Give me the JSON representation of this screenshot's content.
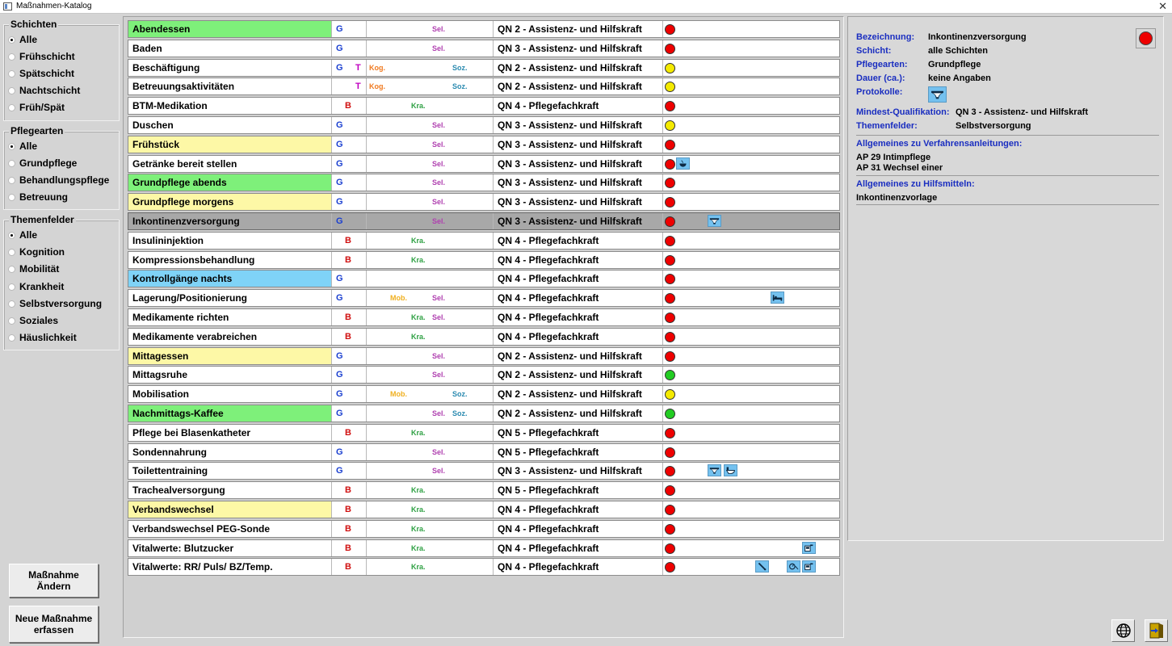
{
  "window": {
    "title": "Maßnahmen-Katalog",
    "close_glyph": "✕"
  },
  "filters": {
    "schichten": {
      "legend": "Schichten",
      "options": [
        "Alle",
        "Frühschicht",
        "Spätschicht",
        "Nachtschicht",
        "Früh/Spät"
      ],
      "selected": 0
    },
    "pflegearten": {
      "legend": "Pflegearten",
      "options": [
        "Alle",
        "Grundpflege",
        "Behandlungspflege",
        "Betreuung"
      ],
      "selected": 0
    },
    "themenfelder": {
      "legend": "Themenfelder",
      "options": [
        "Alle",
        "Kognition",
        "Mobilität",
        "Krankheit",
        "Selbstversorgung",
        "Soziales",
        "Häuslichkeit"
      ],
      "selected": 0
    }
  },
  "buttons": {
    "edit": "Maßnahme Ändern",
    "new": "Neue Maßnahme erfassen"
  },
  "colors": {
    "green": "#7ef07a",
    "yellow": "#fdf8a6",
    "blue": "#7fd3f7",
    "selected": "#a8a8a8"
  },
  "rows": [
    {
      "name": "Abendessen",
      "highlight": "green",
      "g": "G",
      "t": "",
      "b": "",
      "kog": "",
      "mob": "",
      "kra": "",
      "sel": "Sel.",
      "soz": "",
      "qual": "QN 2 - Assistenz- und Hilfskraft",
      "status": "red",
      "icons": []
    },
    {
      "name": "Baden",
      "highlight": "",
      "g": "G",
      "t": "",
      "b": "",
      "kog": "",
      "mob": "",
      "kra": "",
      "sel": "Sel.",
      "soz": "",
      "qual": "QN 3 - Assistenz- und Hilfskraft",
      "status": "red",
      "icons": []
    },
    {
      "name": "Beschäftigung",
      "highlight": "",
      "g": "G",
      "t": "T",
      "b": "",
      "kog": "Kog.",
      "mob": "",
      "kra": "",
      "sel": "",
      "soz": "Soz.",
      "qual": "QN 2 - Assistenz- und Hilfskraft",
      "status": "yellow",
      "icons": []
    },
    {
      "name": "Betreuungsaktivitäten",
      "highlight": "",
      "g": "",
      "t": "T",
      "b": "",
      "kog": "Kog.",
      "mob": "",
      "kra": "",
      "sel": "",
      "soz": "Soz.",
      "qual": "QN 2 - Assistenz- und Hilfskraft",
      "status": "yellow",
      "icons": []
    },
    {
      "name": "BTM-Medikation",
      "highlight": "",
      "g": "",
      "t": "",
      "b": "B",
      "kog": "",
      "mob": "",
      "kra": "Kra.",
      "sel": "",
      "soz": "",
      "qual": "QN 4 - Pflegefachkraft",
      "status": "red",
      "icons": []
    },
    {
      "name": "Duschen",
      "highlight": "",
      "g": "G",
      "t": "",
      "b": "",
      "kog": "",
      "mob": "",
      "kra": "",
      "sel": "Sel.",
      "soz": "",
      "qual": "QN 3 - Assistenz- und Hilfskraft",
      "status": "yellow",
      "icons": []
    },
    {
      "name": "Frühstück",
      "highlight": "yellow",
      "g": "G",
      "t": "",
      "b": "",
      "kog": "",
      "mob": "",
      "kra": "",
      "sel": "Sel.",
      "soz": "",
      "qual": "QN 3 - Assistenz- und Hilfskraft",
      "status": "red",
      "icons": []
    },
    {
      "name": "Getränke bereit stellen",
      "highlight": "",
      "g": "G",
      "t": "",
      "b": "",
      "kog": "",
      "mob": "",
      "kra": "",
      "sel": "Sel.",
      "soz": "",
      "qual": "QN 3 - Assistenz- und Hilfskraft",
      "status": "red",
      "icons": [
        {
          "name": "cup-icon",
          "slot": 0
        }
      ]
    },
    {
      "name": "Grundpflege abends",
      "highlight": "green",
      "g": "G",
      "t": "",
      "b": "",
      "kog": "",
      "mob": "",
      "kra": "",
      "sel": "Sel.",
      "soz": "",
      "qual": "QN 3 - Assistenz- und Hilfskraft",
      "status": "red",
      "icons": []
    },
    {
      "name": "Grundpflege morgens",
      "highlight": "yellow",
      "g": "G",
      "t": "",
      "b": "",
      "kog": "",
      "mob": "",
      "kra": "",
      "sel": "Sel.",
      "soz": "",
      "qual": "QN 3 - Assistenz- und Hilfskraft",
      "status": "red",
      "icons": []
    },
    {
      "name": "Inkontinenzversorgung",
      "highlight": "selected",
      "g": "G",
      "t": "",
      "b": "",
      "kog": "",
      "mob": "",
      "kra": "",
      "sel": "Sel.",
      "soz": "",
      "qual": "QN 3 - Assistenz- und Hilfskraft",
      "status": "red",
      "icons": [
        {
          "name": "brief-icon",
          "slot": 2
        }
      ]
    },
    {
      "name": "Insulininjektion",
      "highlight": "",
      "g": "",
      "t": "",
      "b": "B",
      "kog": "",
      "mob": "",
      "kra": "Kra.",
      "sel": "",
      "soz": "",
      "qual": "QN 4 - Pflegefachkraft",
      "status": "red",
      "icons": []
    },
    {
      "name": "Kompressionsbehandlung",
      "highlight": "",
      "g": "",
      "t": "",
      "b": "B",
      "kog": "",
      "mob": "",
      "kra": "Kra.",
      "sel": "",
      "soz": "",
      "qual": "QN 4 - Pflegefachkraft",
      "status": "red",
      "icons": []
    },
    {
      "name": "Kontrollgänge nachts",
      "highlight": "blue",
      "g": "G",
      "t": "",
      "b": "",
      "kog": "",
      "mob": "",
      "kra": "",
      "sel": "",
      "soz": "",
      "qual": "QN 4 - Pflegefachkraft",
      "status": "red",
      "icons": []
    },
    {
      "name": "Lagerung/Positionierung",
      "highlight": "",
      "g": "G",
      "t": "",
      "b": "",
      "kog": "",
      "mob": "Mob.",
      "kra": "",
      "sel": "Sel.",
      "soz": "",
      "qual": "QN 4 - Pflegefachkraft",
      "status": "red",
      "icons": [
        {
          "name": "bed-icon",
          "slot": 6
        }
      ]
    },
    {
      "name": "Medikamente richten",
      "highlight": "",
      "g": "",
      "t": "",
      "b": "B",
      "kog": "",
      "mob": "",
      "kra": "Kra.",
      "sel": "Sel.",
      "soz": "",
      "qual": "QN 4 - Pflegefachkraft",
      "status": "red",
      "icons": []
    },
    {
      "name": "Medikamente verabreichen",
      "highlight": "",
      "g": "",
      "t": "",
      "b": "B",
      "kog": "",
      "mob": "",
      "kra": "Kra.",
      "sel": "",
      "soz": "",
      "qual": "QN 4 - Pflegefachkraft",
      "status": "red",
      "icons": []
    },
    {
      "name": "Mittagessen",
      "highlight": "yellow",
      "g": "G",
      "t": "",
      "b": "",
      "kog": "",
      "mob": "",
      "kra": "",
      "sel": "Sel.",
      "soz": "",
      "qual": "QN 2 - Assistenz- und Hilfskraft",
      "status": "red",
      "icons": []
    },
    {
      "name": "Mittagsruhe",
      "highlight": "",
      "g": "G",
      "t": "",
      "b": "",
      "kog": "",
      "mob": "",
      "kra": "",
      "sel": "Sel.",
      "soz": "",
      "qual": "QN 2 - Assistenz- und Hilfskraft",
      "status": "green",
      "icons": []
    },
    {
      "name": "Mobilisation",
      "highlight": "",
      "g": "G",
      "t": "",
      "b": "",
      "kog": "",
      "mob": "Mob.",
      "kra": "",
      "sel": "",
      "soz": "Soz.",
      "qual": "QN 2 - Assistenz- und Hilfskraft",
      "status": "yellow",
      "icons": []
    },
    {
      "name": "Nachmittags-Kaffee",
      "highlight": "green",
      "g": "G",
      "t": "",
      "b": "",
      "kog": "",
      "mob": "",
      "kra": "",
      "sel": "Sel.",
      "soz": "Soz.",
      "qual": "QN 2 - Assistenz- und Hilfskraft",
      "status": "green",
      "icons": []
    },
    {
      "name": "Pflege bei Blasenkatheter",
      "highlight": "",
      "g": "",
      "t": "",
      "b": "B",
      "kog": "",
      "mob": "",
      "kra": "Kra.",
      "sel": "",
      "soz": "",
      "qual": "QN 5 - Pflegefachkraft",
      "status": "red",
      "icons": []
    },
    {
      "name": "Sondennahrung",
      "highlight": "",
      "g": "G",
      "t": "",
      "b": "",
      "kog": "",
      "mob": "",
      "kra": "",
      "sel": "Sel.",
      "soz": "",
      "qual": "QN 5 - Pflegefachkraft",
      "status": "red",
      "icons": []
    },
    {
      "name": "Toilettentraining",
      "highlight": "",
      "g": "G",
      "t": "",
      "b": "",
      "kog": "",
      "mob": "",
      "kra": "",
      "sel": "Sel.",
      "soz": "",
      "qual": "QN 3 - Assistenz- und Hilfskraft",
      "status": "red",
      "icons": [
        {
          "name": "brief-icon",
          "slot": 2
        },
        {
          "name": "toilet-icon",
          "slot": 3
        }
      ]
    },
    {
      "name": "Trachealversorgung",
      "highlight": "",
      "g": "",
      "t": "",
      "b": "B",
      "kog": "",
      "mob": "",
      "kra": "Kra.",
      "sel": "",
      "soz": "",
      "qual": "QN 5 - Pflegefachkraft",
      "status": "red",
      "icons": []
    },
    {
      "name": "Verbandswechsel",
      "highlight": "yellow",
      "g": "",
      "t": "",
      "b": "B",
      "kog": "",
      "mob": "",
      "kra": "Kra.",
      "sel": "",
      "soz": "",
      "qual": "QN 4 - Pflegefachkraft",
      "status": "red",
      "icons": []
    },
    {
      "name": "Verbandswechsel PEG-Sonde",
      "highlight": "",
      "g": "",
      "t": "",
      "b": "B",
      "kog": "",
      "mob": "",
      "kra": "Kra.",
      "sel": "",
      "soz": "",
      "qual": "QN 4 - Pflegefachkraft",
      "status": "red",
      "icons": []
    },
    {
      "name": "Vitalwerte: Blutzucker",
      "highlight": "",
      "g": "",
      "t": "",
      "b": "B",
      "kog": "",
      "mob": "",
      "kra": "Kra.",
      "sel": "",
      "soz": "",
      "qual": "QN 4 - Pflegefachkraft",
      "status": "red",
      "icons": [
        {
          "name": "glucometer-icon",
          "slot": 8
        }
      ]
    },
    {
      "name": "Vitalwerte: RR/ Puls/ BZ/Temp.",
      "highlight": "",
      "g": "",
      "t": "",
      "b": "B",
      "kog": "",
      "mob": "",
      "kra": "Kra.",
      "sel": "",
      "soz": "",
      "qual": "QN 4 - Pflegefachkraft",
      "status": "red",
      "icons": [
        {
          "name": "thermometer-icon",
          "slot": 5
        },
        {
          "name": "blood-pressure-icon",
          "slot": 7
        },
        {
          "name": "glucometer-icon",
          "slot": 8
        }
      ]
    }
  ],
  "detail": {
    "bezeichnung_label": "Bezeichnung:",
    "bezeichnung": "Inkontinenzversorgung",
    "schicht_label": "Schicht:",
    "schicht": "alle Schichten",
    "pflegearten_label": "Pflegearten:",
    "pflegearten": "Grundpflege",
    "dauer_label": "Dauer (ca.):",
    "dauer": "keine Angaben",
    "protokolle_label": "Protokolle:",
    "qual_label": "Mindest-Qualifikation:",
    "qual": "QN 3 - Assistenz- und Hilfskraft",
    "themen_label": "Themenfelder:",
    "themen": "Selbstversorgung",
    "verfahren_label": "Allgemeines zu Verfahrensanleitungen:",
    "verfahren": [
      "AP 29 Intimpflege",
      "AP 31 Wechsel einer"
    ],
    "hilfsmittel_label": "Allgemeines zu Hilfsmitteln:",
    "hilfsmittel": "Inkontinenzvorlage",
    "status": "red"
  }
}
